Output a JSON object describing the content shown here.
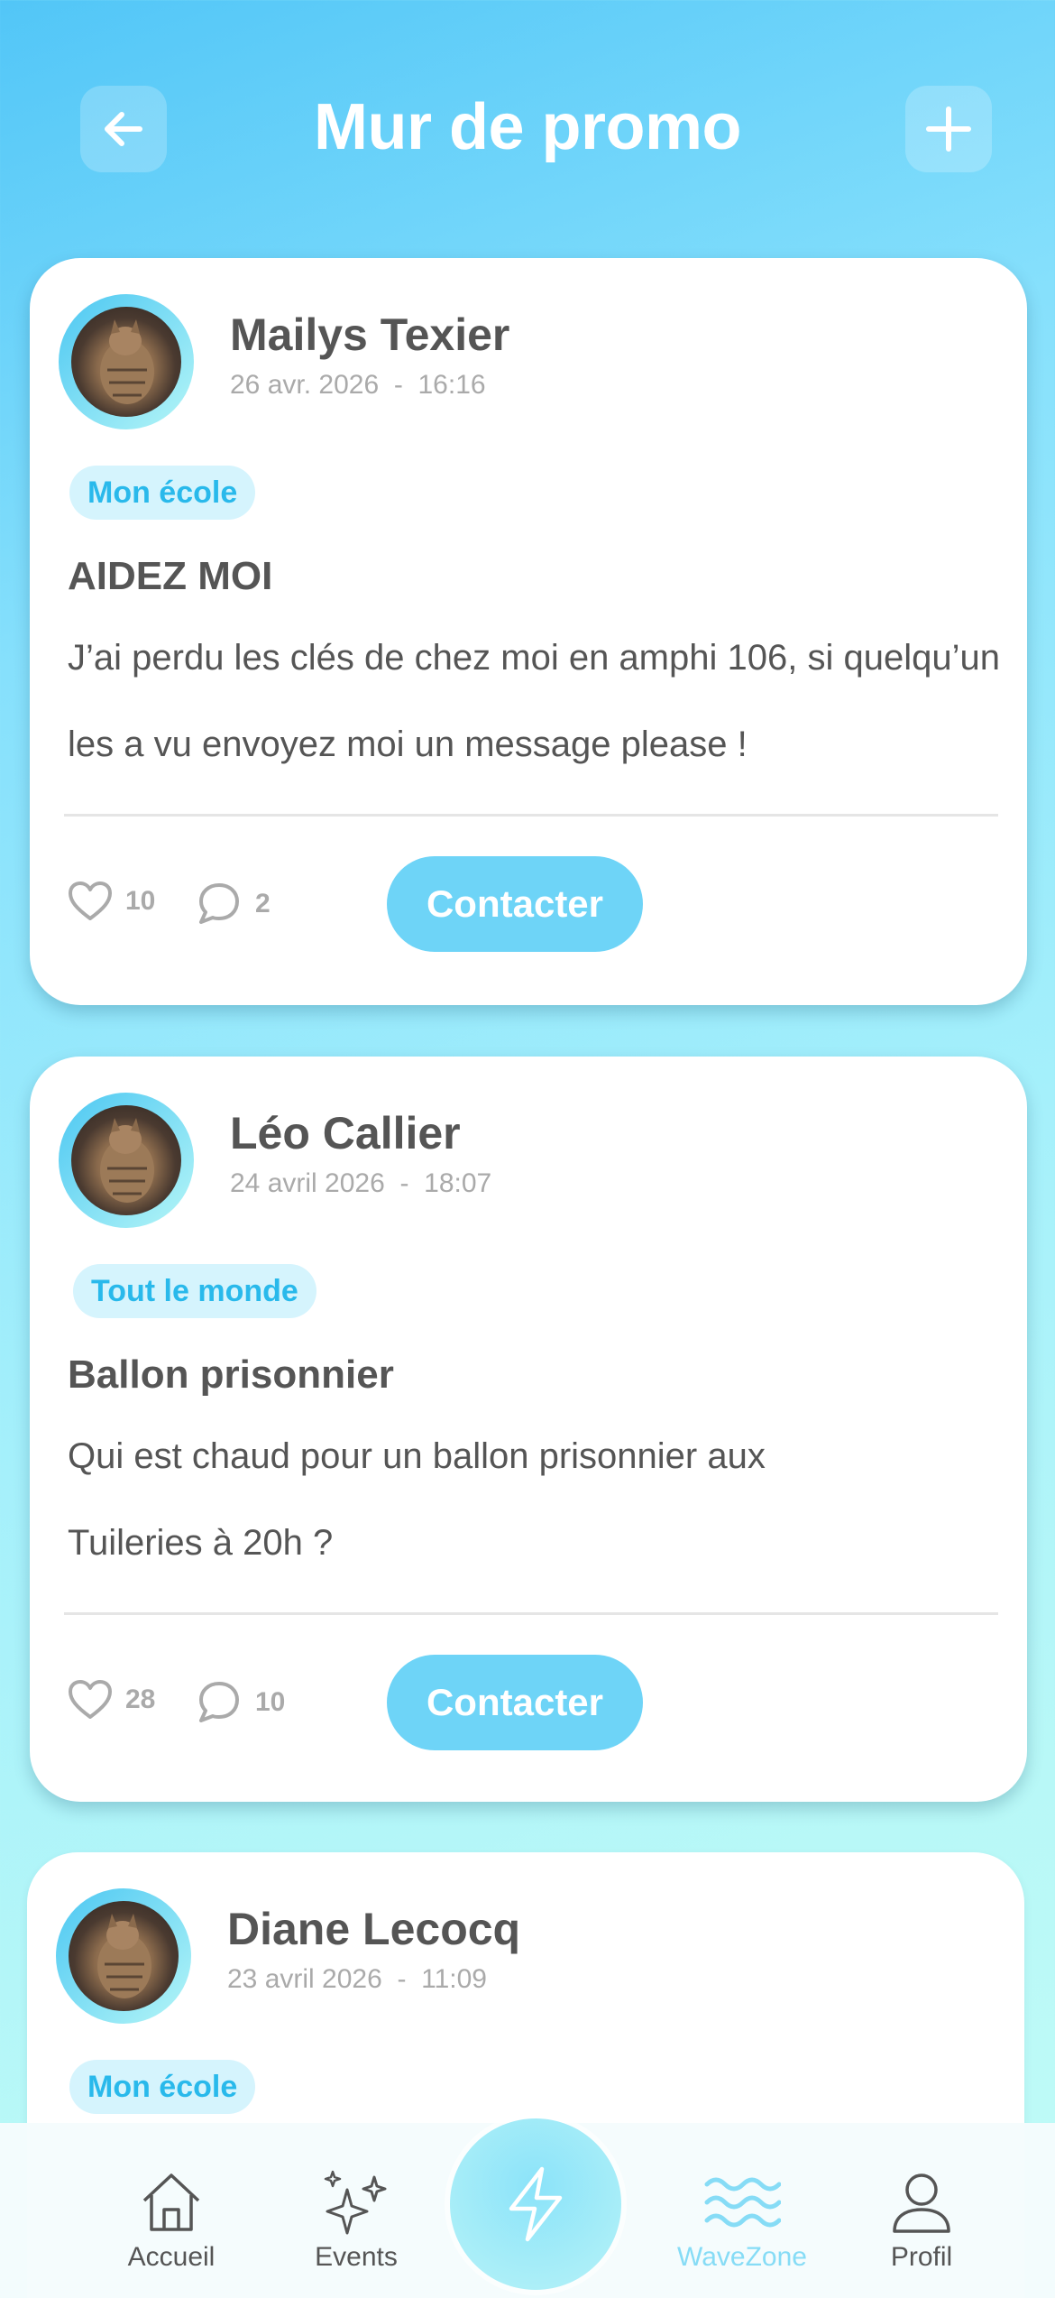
{
  "header": {
    "title": "Mur de promo",
    "back_icon": "arrow-left-icon",
    "add_icon": "plus-icon"
  },
  "posts": [
    {
      "author": "Mailys Texier",
      "date": "26 avr. 2026",
      "time": "16:16",
      "date_separator": "-",
      "audience": "Mon école",
      "title": "AIDEZ MOI",
      "body": "J’ai perdu les clés de chez moi en amphi 106, si quelqu’un les a vu envoyez moi un message please !",
      "likes": "10",
      "comments": "2",
      "contact_label": "Contacter"
    },
    {
      "author": "Léo Callier",
      "date": "24 avril 2026",
      "time": "18:07",
      "date_separator": "-",
      "audience": "Tout le monde",
      "title": "Ballon prisonnier",
      "body": "Qui est chaud pour un ballon prisonnier aux Tuileries à 20h ?",
      "likes": "28",
      "comments": "10",
      "contact_label": "Contacter"
    },
    {
      "author": "Diane Lecocq",
      "date": "23 avril 2026",
      "time": "11:09",
      "date_separator": "-",
      "audience": "Mon école"
    }
  ],
  "nav": {
    "items": [
      {
        "label": "Accueil",
        "icon": "home-icon"
      },
      {
        "label": "Events",
        "icon": "sparkles-icon"
      },
      {
        "label": "",
        "icon": "lightning-icon"
      },
      {
        "label": "WaveZone",
        "icon": "waves-icon",
        "active": true
      },
      {
        "label": "Profil",
        "icon": "user-icon"
      }
    ]
  },
  "colors": {
    "accent": "#6ed4f7",
    "tag_bg": "#d5f4fd",
    "tag_text": "#29b9eb",
    "active_nav": "#86dcf6"
  }
}
